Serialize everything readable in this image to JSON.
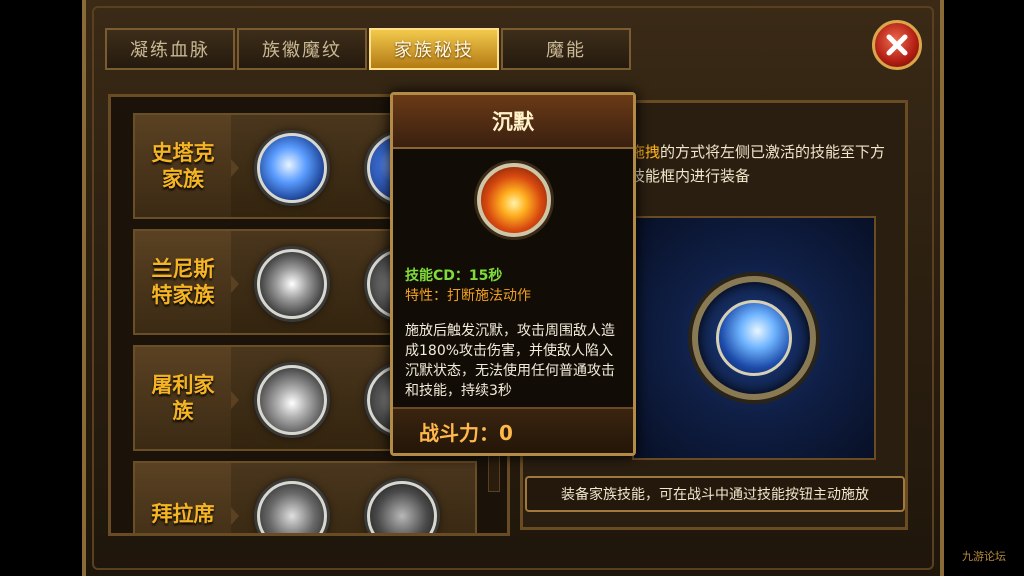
{
  "tabs": [
    {
      "label": "凝练血脉"
    },
    {
      "label": "族徽魔纹"
    },
    {
      "label": "家族秘技"
    },
    {
      "label": "魔能"
    }
  ],
  "clans": [
    {
      "name": "史塔克\n家族"
    },
    {
      "name": "兰尼斯\n特家族"
    },
    {
      "name": "屠利家\n族"
    },
    {
      "name": "拜拉席"
    }
  ],
  "tooltip": {
    "title": "沉默",
    "cd": "技能CD：15秒",
    "trait": "特性：打断施法动作",
    "description": "施放后触发沉默，攻击周围敌人造成180%攻击伤害，并使敌人陷入沉默状态，无法使用任何普通攻击和技能，持续3秒",
    "power": "战斗力：0"
  },
  "right": {
    "hint_highlight": "拖拽",
    "hint_rest": "的方式将左侧已激活的技能至下方技能框内进行装备",
    "equip_text": "装备家族技能，可在战斗中通过技能按钮主动施放"
  },
  "watermark": "九游论坛",
  "colors": {
    "active_tab": "#f2c94c",
    "clan_name": "#f5b423",
    "cd_green": "#7fdc3a",
    "trait_orange": "#f0a020"
  }
}
